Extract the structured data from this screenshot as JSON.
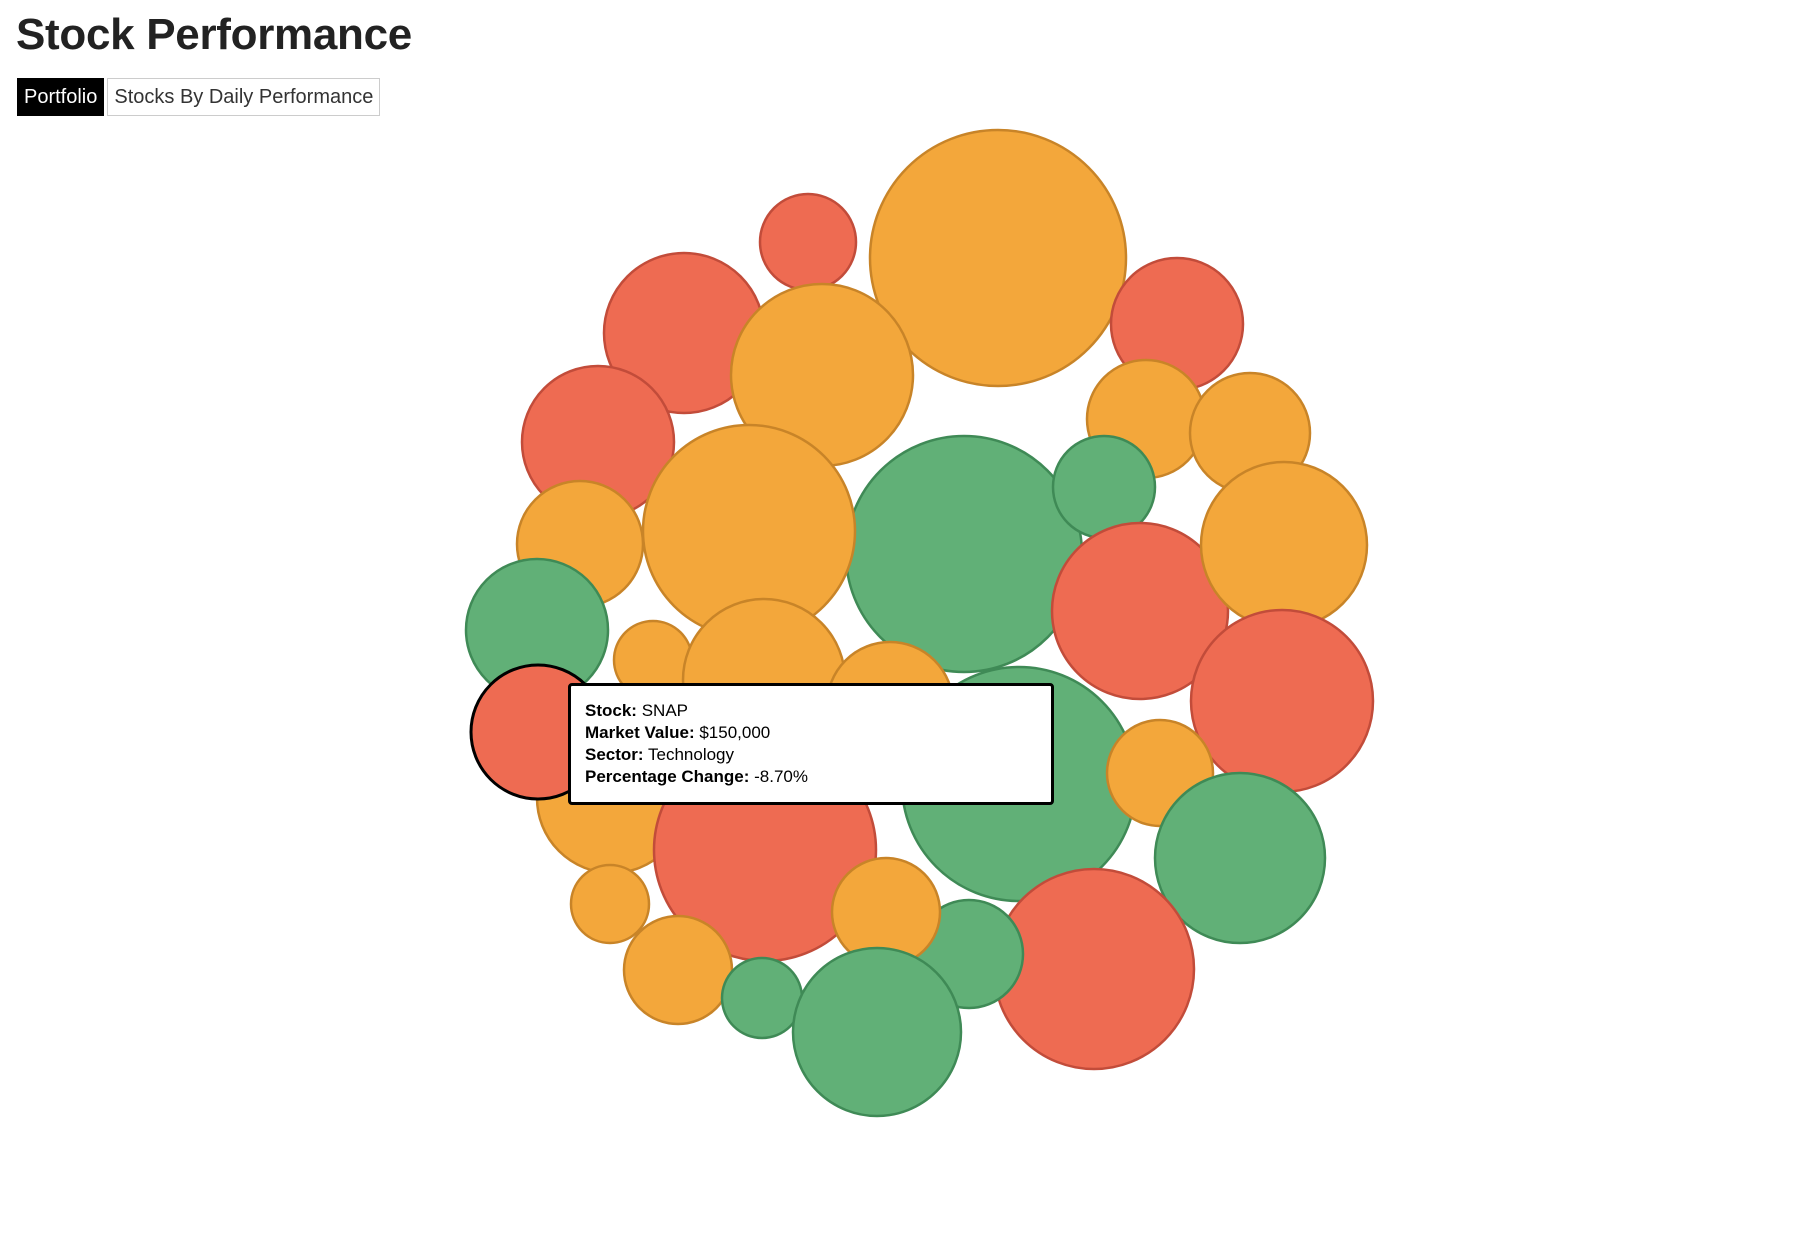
{
  "page": {
    "title": "Stock Performance"
  },
  "view_buttons": [
    {
      "label": "Portfolio",
      "active": true
    },
    {
      "label": "Stocks By Daily Performance",
      "active": false
    }
  ],
  "colors": {
    "positive": "#61b077",
    "positive_stroke": "#3f8a56",
    "neutral": "#f3a73b",
    "neutral_stroke": "#c88428",
    "negative": "#ee6b52",
    "negative_stroke": "#c24c3a",
    "highlight_stroke": "#000000"
  },
  "tooltip": {
    "stock_label": "Stock:",
    "stock_value": "SNAP",
    "market_value_label": "Market Value:",
    "market_value_value": "$150,000",
    "sector_label": "Sector:",
    "sector_value": "Technology",
    "pct_label": "Percentage Change:",
    "pct_value": "-8.70%"
  }
}
